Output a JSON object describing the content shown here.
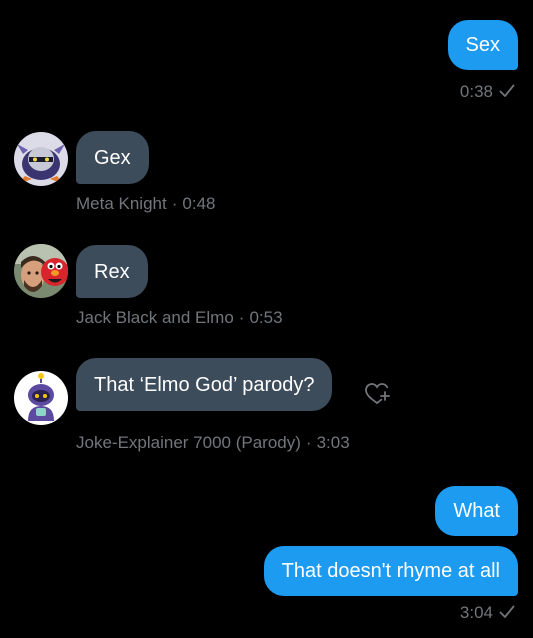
{
  "messages": [
    {
      "text": "Sex",
      "time": "0:38"
    },
    {
      "text": "Gex",
      "sender": "Meta Knight",
      "time": "0:48"
    },
    {
      "text": "Rex",
      "sender": "Jack Black and Elmo",
      "time": "0:53"
    },
    {
      "text": "That ‘Elmo God’ parody?",
      "sender": "Joke-Explainer 7000 (Parody)",
      "time": "3:03"
    },
    {
      "text": "What"
    },
    {
      "text": "That doesn't rhyme at all",
      "time": "3:04"
    }
  ],
  "meta_separator": "·",
  "icons": {
    "read_receipt": "check-icon",
    "like": "heart-plus-icon"
  },
  "colors": {
    "background": "#000000",
    "outgoing_bubble": "#1d9bf0",
    "incoming_bubble": "#3d4c5b",
    "meta_text": "#71767b"
  }
}
